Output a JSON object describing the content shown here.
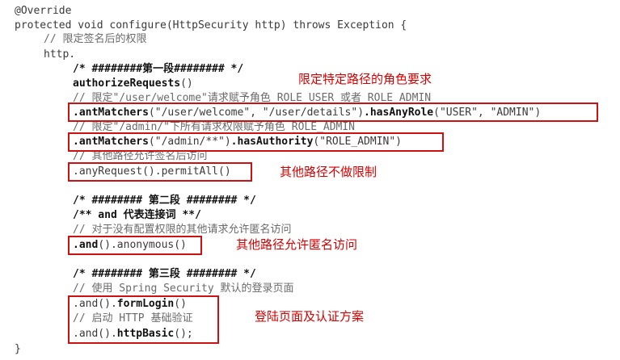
{
  "code": {
    "l1": "@Override",
    "l2": "protected void configure(HttpSecurity http) throws Exception {",
    "l3": "// 限定签名后的权限",
    "l4": "http.",
    "l5": "/* ########第一段######## */",
    "l6": "authorizeRequests",
    "l6b": "()",
    "l7": "// 限定\"/user/welcome\"请求赋予角色 ROLE_USER 或者 ROLE_ADMIN",
    "l8a": ".antMatchers",
    "l8b": "(\"/user/welcome\", \"/user/details\")",
    "l8c": ".hasAnyRole",
    "l8d": "(\"USER\", \"ADMIN\")",
    "l9": "// 限定\"/admin/\"下所有请求权限赋予角色 ROLE_ADMIN",
    "l10a": ".antMatchers",
    "l10b": "(\"/admin/**\")",
    "l10c": ".hasAuthority",
    "l10d": "(\"ROLE_ADMIN\")",
    "l11": "// 其他路径允许签名后访问",
    "l12": ".anyRequest().permitAll()",
    "l13": "/* ######## 第二段 ######## */",
    "l14": "/** and 代表连接词 **/",
    "l15": "// 对于没有配置权限的其他请求允许匿名访问",
    "l16a": ".and",
    "l16b": "().anonymous()",
    "l17": "/* ######## 第三段 ######## */",
    "l18": "// 使用 Spring Security 默认的登录页面",
    "l19a": ".and().",
    "l19b": "formLogin",
    "l19c": "()",
    "l20": "// 启动 HTTP 基础验证",
    "l21a": ".and().",
    "l21b": "httpBasic",
    "l21c": "();",
    "l22": "}"
  },
  "annotations": {
    "a1": "限定特定路径的角色要求",
    "a2": "其他路径不做限制",
    "a3": "其他路径允许匿名访问",
    "a4": "登陆页面及认证方案"
  },
  "colors": {
    "highlight_box": "#cc1111",
    "annotation_text": "#d40000"
  }
}
